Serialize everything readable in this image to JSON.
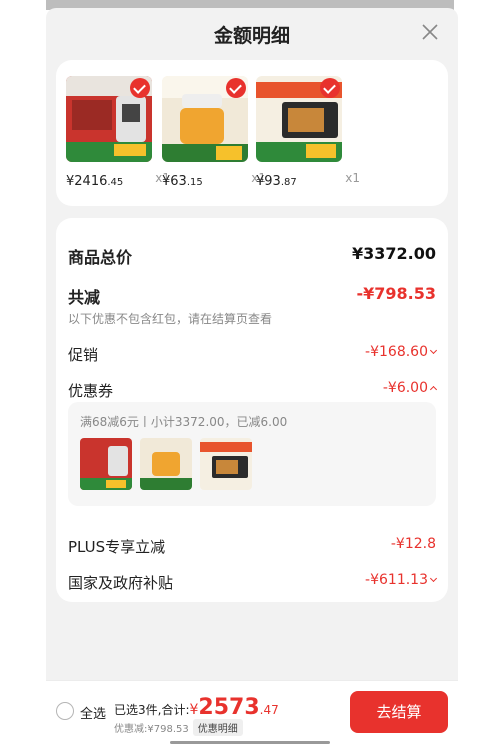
{
  "header": {
    "title": "金额明细"
  },
  "products": [
    {
      "price_int": "¥2416",
      "price_dec": ".45",
      "qty": "x1"
    },
    {
      "price_int": "¥63",
      "price_dec": ".15",
      "qty": "x1"
    },
    {
      "price_int": "¥93",
      "price_dec": ".87",
      "qty": "x1"
    }
  ],
  "summary": {
    "total_label": "商品总价",
    "total_value": "¥3372.00",
    "reduce_label": "共减",
    "reduce_value": "-¥798.53",
    "reduce_note": "以下优惠不包含红包，请在结算页查看",
    "promo_label": "促销",
    "promo_value": "-¥168.60",
    "coupon_label": "优惠券",
    "coupon_value": "-¥6.00",
    "coupon_detail": "满68减6元丨小计3372.00，已减6.00",
    "plus_label": "PLUS专享立减",
    "plus_value": "-¥12.8",
    "subsidy_label": "国家及政府补贴",
    "subsidy_value": "-¥611.13"
  },
  "bottom": {
    "select_all": "全选",
    "selected_text": "已选3件,合计:",
    "total_yen": "¥",
    "total_int": "2573",
    "total_dec": ".47",
    "discount_text": "优惠减:¥798.53",
    "detail_tag": "优惠明细",
    "checkout": "去结算"
  },
  "colors": {
    "accent": "#e8322d",
    "sheet_bg": "#f2f2f2"
  }
}
